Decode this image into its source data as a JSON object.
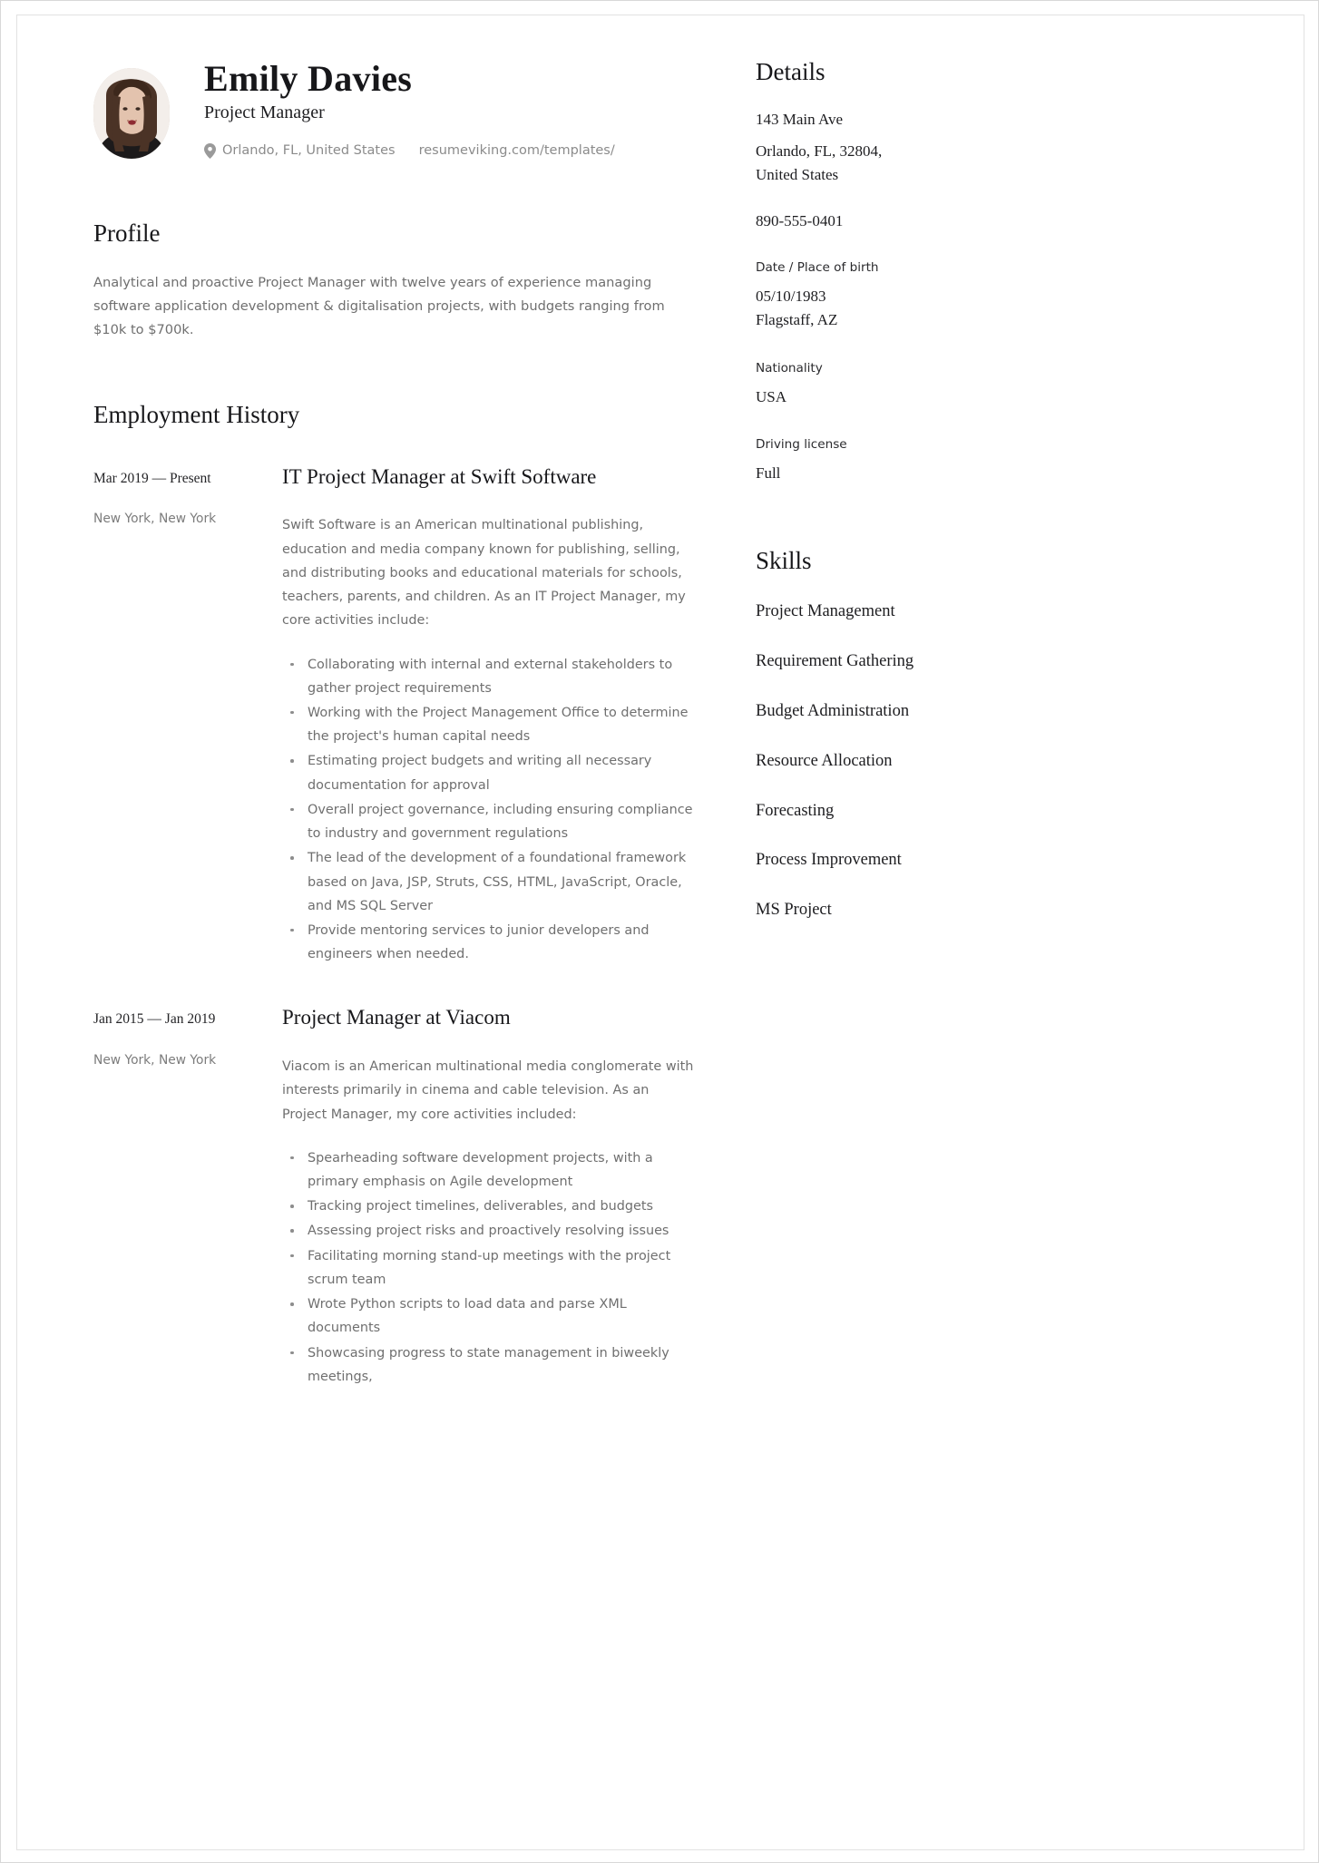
{
  "header": {
    "name": "Emily Davies",
    "job_title": "Project Manager",
    "location": "Orlando, FL, United States",
    "website": "resumeviking.com/templates/",
    "location_icon": "map-pin-icon",
    "photo_alt": "profile-photo"
  },
  "profile": {
    "heading": "Profile",
    "text": "Analytical and proactive Project Manager with twelve years of experience managing software application development & digitalisation projects, with budgets ranging from $10k to $700k."
  },
  "employment": {
    "heading": "Employment History",
    "jobs": [
      {
        "dates": "Mar 2019 — Present",
        "location": "New York, New York",
        "title": "IT Project Manager at  Swift Software",
        "description": "Swift Software is an American multinational publishing, education and media company known for publishing, selling, and distributing books and educational materials for schools, teachers, parents, and children. As an IT Project Manager, my core activities include:",
        "bullets": [
          "Collaborating with internal and external stakeholders to gather project requirements",
          "Working with the Project Management Office to determine the project's human capital needs",
          "Estimating project budgets and writing all necessary documentation for approval",
          "Overall project governance, including ensuring compliance to industry and government regulations",
          "The lead of the development of a foundational framework based on Java, JSP, Struts, CSS, HTML, JavaScript, Oracle, and MS SQL Server",
          "Provide mentoring services to junior developers and engineers when needed."
        ]
      },
      {
        "dates": "Jan 2015 — Jan 2019",
        "location": "New York, New York",
        "title": "Project Manager at  Viacom",
        "description": "Viacom is an American multinational media conglomerate with interests primarily in cinema and cable television. As an Project Manager, my core activities included:",
        "bullets": [
          "Spearheading software development projects, with a primary emphasis on Agile development",
          "Tracking project timelines, deliverables, and budgets",
          "Assessing project risks and proactively resolving issues",
          "Facilitating morning stand-up meetings with the project scrum team",
          "Wrote Python scripts to load data and parse XML documents",
          "Showcasing progress to state management in biweekly meetings,"
        ]
      }
    ]
  },
  "details": {
    "heading": "Details",
    "address_line1": "143 Main Ave",
    "address_line2": "Orlando, FL, 32804,\nUnited States",
    "phone": "890-555-0401",
    "fields": [
      {
        "label": "Date / Place of birth",
        "value": "05/10/1983\nFlagstaff, AZ"
      },
      {
        "label": "Nationality",
        "value": "USA"
      },
      {
        "label": "Driving license",
        "value": "Full"
      }
    ]
  },
  "skills": {
    "heading": "Skills",
    "items": [
      "Project Management",
      "Requirement Gathering",
      "Budget Administration",
      "Resource Allocation",
      "Forecasting",
      "Process Improvement",
      "MS Project"
    ]
  }
}
